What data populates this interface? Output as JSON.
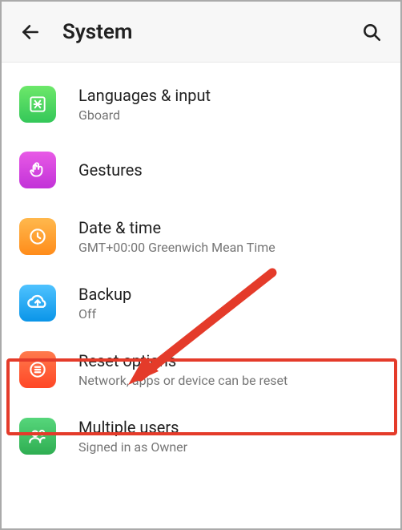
{
  "header": {
    "title": "System"
  },
  "items": [
    {
      "title": "Languages & input",
      "sub": "Gboard",
      "icon": "languages-icon",
      "color": "#4cd964"
    },
    {
      "title": "Gestures",
      "sub": "",
      "icon": "gestures-icon",
      "color": "#d43ae8"
    },
    {
      "title": "Date & time",
      "sub": "GMT+00:00 Greenwich Mean Time",
      "icon": "clock-icon",
      "color": "#ff9b1a"
    },
    {
      "title": "Backup",
      "sub": "Off",
      "icon": "backup-icon",
      "color": "#1aa7ff"
    },
    {
      "title": "Reset options",
      "sub": "Network, apps or device can be reset",
      "icon": "reset-icon",
      "color": "#ff4f2e"
    },
    {
      "title": "Multiple users",
      "sub": "Signed in as Owner",
      "icon": "users-icon",
      "color": "#3bbf5a"
    }
  ],
  "annotation": {
    "highlighted_item": "Reset options"
  }
}
